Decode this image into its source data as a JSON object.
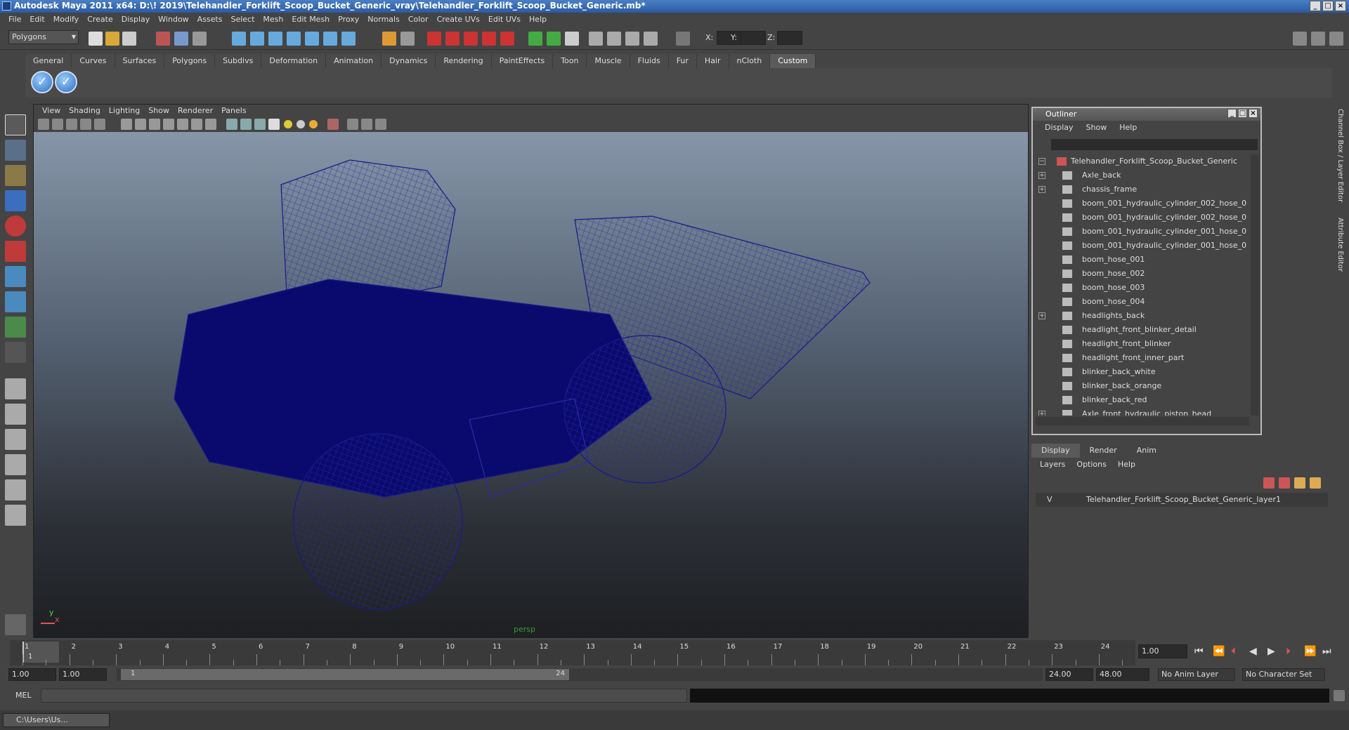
{
  "window": {
    "title": "Autodesk Maya 2011 x64: D:\\! 2019\\Telehandler_Forklift_Scoop_Bucket_Generic_vray\\Telehandler_Forklift_Scoop_Bucket_Generic.mb*"
  },
  "menubar": [
    "File",
    "Edit",
    "Modify",
    "Create",
    "Display",
    "Window",
    "Assets",
    "Select",
    "Mesh",
    "Edit Mesh",
    "Proxy",
    "Normals",
    "Color",
    "Create UVs",
    "Edit UVs",
    "Help"
  ],
  "statusline": {
    "mode": "Polygons",
    "x_label": "X:",
    "y_label": "Y:",
    "z_label": "Z:"
  },
  "shelf": {
    "tabs": [
      "General",
      "Curves",
      "Surfaces",
      "Polygons",
      "Subdivs",
      "Deformation",
      "Animation",
      "Dynamics",
      "Rendering",
      "PaintEffects",
      "Toon",
      "Muscle",
      "Fluids",
      "Fur",
      "Hair",
      "nCloth",
      "Custom"
    ],
    "active_tab": "Custom"
  },
  "viewport": {
    "menu": [
      "View",
      "Shading",
      "Lighting",
      "Show",
      "Renderer",
      "Panels"
    ],
    "camera_label": "persp",
    "axis_x": "x",
    "axis_y": "y",
    "wire_color": "#0a0a6e"
  },
  "outliner": {
    "title": "Outliner",
    "menu": [
      "Display",
      "Show",
      "Help"
    ],
    "items": [
      {
        "label": "Telehandler_Forklift_Scoop_Bucket_Generic",
        "expand": "−",
        "root": true
      },
      {
        "label": "Axle_back",
        "expand": "+"
      },
      {
        "label": "chassis_frame",
        "expand": "+"
      },
      {
        "label": "boom_001_hydraulic_cylinder_002_hose_0",
        "expand": ""
      },
      {
        "label": "boom_001_hydraulic_cylinder_002_hose_0",
        "expand": ""
      },
      {
        "label": "boom_001_hydraulic_cylinder_001_hose_0",
        "expand": ""
      },
      {
        "label": "boom_001_hydraulic_cylinder_001_hose_0",
        "expand": ""
      },
      {
        "label": "boom_hose_001",
        "expand": ""
      },
      {
        "label": "boom_hose_002",
        "expand": ""
      },
      {
        "label": "boom_hose_003",
        "expand": ""
      },
      {
        "label": "boom_hose_004",
        "expand": ""
      },
      {
        "label": "headlights_back",
        "expand": "+"
      },
      {
        "label": "headlight_front_blinker_detail",
        "expand": ""
      },
      {
        "label": "headlight_front_blinker",
        "expand": ""
      },
      {
        "label": "headlight_front_inner_part",
        "expand": ""
      },
      {
        "label": "blinker_back_white",
        "expand": ""
      },
      {
        "label": "blinker_back_orange",
        "expand": ""
      },
      {
        "label": "blinker_back_red",
        "expand": ""
      },
      {
        "label": "Axle_front_hydraulic_piston_head",
        "expand": "+"
      }
    ]
  },
  "layers": {
    "tabs": [
      "Display",
      "Render",
      "Anim"
    ],
    "active_tab": "Display",
    "menu": [
      "Layers",
      "Options",
      "Help"
    ],
    "row": {
      "visible": "V",
      "name": "Telehandler_Forklift_Scoop_Bucket_Generic_layer1"
    }
  },
  "right_strip": {
    "channel_box": "Channel Box / Layer Editor",
    "attribute_editor": "Attribute Editor"
  },
  "timeline": {
    "ticks": [
      "1",
      "2",
      "3",
      "4",
      "5",
      "6",
      "7",
      "8",
      "9",
      "10",
      "11",
      "12",
      "13",
      "14",
      "15",
      "16",
      "17",
      "18",
      "19",
      "20",
      "21",
      "22",
      "23",
      "24"
    ],
    "current_frame_marker": "1",
    "current_frame": "1.00"
  },
  "range": {
    "start": "1.00",
    "playback_start": "1.00",
    "slider_start": "1",
    "slider_end": "24",
    "playback_end": "24.00",
    "end": "48.00",
    "anim_layer": "No Anim Layer",
    "character_set": "No Character Set"
  },
  "command": {
    "label": "MEL"
  },
  "taskbar": {
    "item": "C:\\Users\\Us..."
  }
}
